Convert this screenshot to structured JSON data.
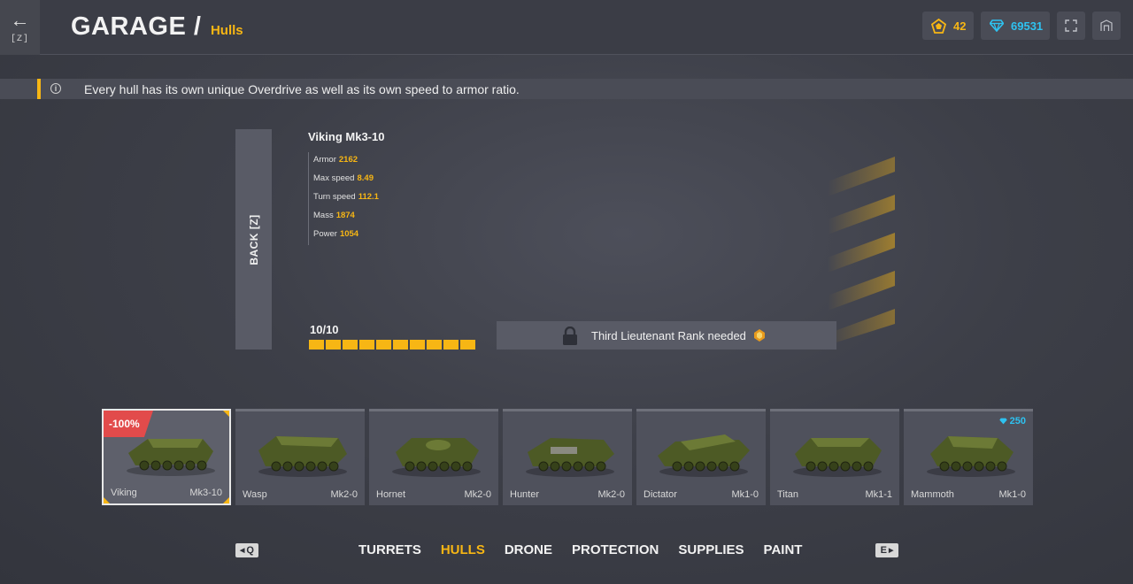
{
  "header": {
    "back_key": "[Z]",
    "title": "GARAGE /",
    "subtitle": "Hulls",
    "crystals": "42",
    "diamonds": "69531"
  },
  "tip": {
    "text": "Every hull has its own unique Overdrive as well as its own speed to armor ratio."
  },
  "details": {
    "back_label": "BACK [Z]",
    "name": "Viking Mk3-10",
    "stats": [
      {
        "label": "Armor",
        "value": "2162"
      },
      {
        "label": "Max speed",
        "value": "8.49"
      },
      {
        "label": "Turn speed",
        "value": "112.1"
      },
      {
        "label": "Mass",
        "value": "1874"
      },
      {
        "label": "Power",
        "value": "1054"
      }
    ],
    "level_text": "10/10",
    "level_progress": 1.0,
    "lock_text": "Third Lieutenant Rank needed"
  },
  "hulls": [
    {
      "name": "Viking",
      "mk": "Mk3-10",
      "badge": "-100%",
      "selected": true
    },
    {
      "name": "Wasp",
      "mk": "Mk2-0"
    },
    {
      "name": "Hornet",
      "mk": "Mk2-0"
    },
    {
      "name": "Hunter",
      "mk": "Mk2-0"
    },
    {
      "name": "Dictator",
      "mk": "Mk1-0"
    },
    {
      "name": "Titan",
      "mk": "Mk1-1"
    },
    {
      "name": "Mammoth",
      "mk": "Mk1-0",
      "price": "250"
    }
  ],
  "nav": {
    "prev_key": "Q",
    "next_key": "E",
    "tabs": [
      "TURRETS",
      "HULLS",
      "DRONE",
      "PROTECTION",
      "SUPPLIES",
      "PAINT"
    ],
    "active_tab": "HULLS"
  },
  "colors": {
    "accent": "#f7b614",
    "diamond": "#2ec2f0",
    "discount": "#e24b4b"
  }
}
